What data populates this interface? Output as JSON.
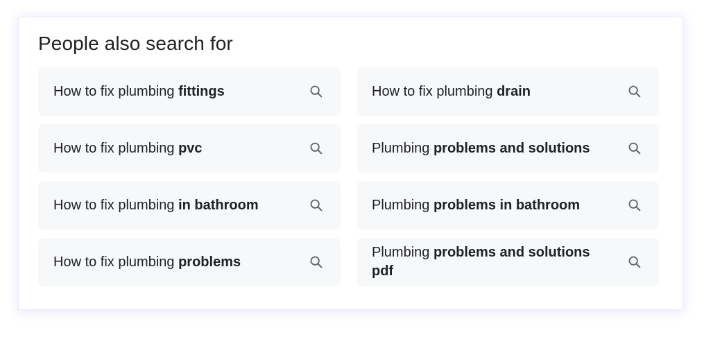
{
  "panel": {
    "title": "People also search for",
    "items": [
      {
        "prefix": "How to fix plumbing ",
        "bold": "fittings"
      },
      {
        "prefix": "How to fix plumbing ",
        "bold": "drain"
      },
      {
        "prefix": "How to fix plumbing ",
        "bold": "pvc"
      },
      {
        "prefix": "Plumbing ",
        "bold": "problems and solutions"
      },
      {
        "prefix": "How to fix plumbing ",
        "bold": "in bathroom"
      },
      {
        "prefix": "Plumbing ",
        "bold": "problems in bathroom"
      },
      {
        "prefix": "How to fix plumbing ",
        "bold": "problems"
      },
      {
        "prefix": "Plumbing ",
        "bold": "problems and solutions pdf"
      }
    ]
  },
  "icons": {
    "chip_icon": "search-icon"
  },
  "colors": {
    "chip_background": "#f7f8f9",
    "text": "#202124",
    "icon": "#5f6368"
  }
}
